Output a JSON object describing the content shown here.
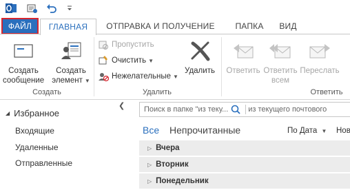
{
  "qat": {
    "icons": [
      "outlook-logo-icon",
      "send-receive-icon",
      "undo-icon",
      "customize-qat-icon"
    ]
  },
  "tabs": {
    "file": "ФАЙЛ",
    "home": "ГЛАВНАЯ",
    "send_receive": "ОТПРАВКА И ПОЛУЧЕНИЕ",
    "folder": "ПАПКА",
    "view": "ВИД"
  },
  "ribbon": {
    "new_group": {
      "label": "Создать",
      "new_email": {
        "line1": "Создать",
        "line2": "сообщение"
      },
      "new_items": {
        "line1": "Создать",
        "line2": "элемент"
      }
    },
    "delete_group": {
      "label": "Удалить",
      "ignore": "Пропустить",
      "clean_up": "Очистить",
      "junk": "Нежелательные",
      "delete": "Удалить"
    },
    "respond_group": {
      "label": "Ответить",
      "reply": {
        "line1": "Ответить",
        "line2": ""
      },
      "reply_all": {
        "line1": "Ответить",
        "line2": "всем"
      },
      "forward": {
        "line1": "Переслать",
        "line2": ""
      }
    }
  },
  "nav": {
    "favorites": "Избранное",
    "items": [
      "Входящие",
      "Удаленные",
      "Отправленные"
    ]
  },
  "main": {
    "search_placeholder": "Поиск в папке \"из теку...",
    "search_scope": "из текущего почтового ",
    "filter_all": "Все",
    "filter_unread": "Непрочитанные",
    "sort_by": "По Дата",
    "sort_order": "Нов",
    "groups": [
      "Вчера",
      "Вторник",
      "Понедельник"
    ]
  },
  "colors": {
    "accent": "#2a6fbd",
    "file_tab_border": "#d6262e",
    "group_row_bg": "#ececec"
  }
}
